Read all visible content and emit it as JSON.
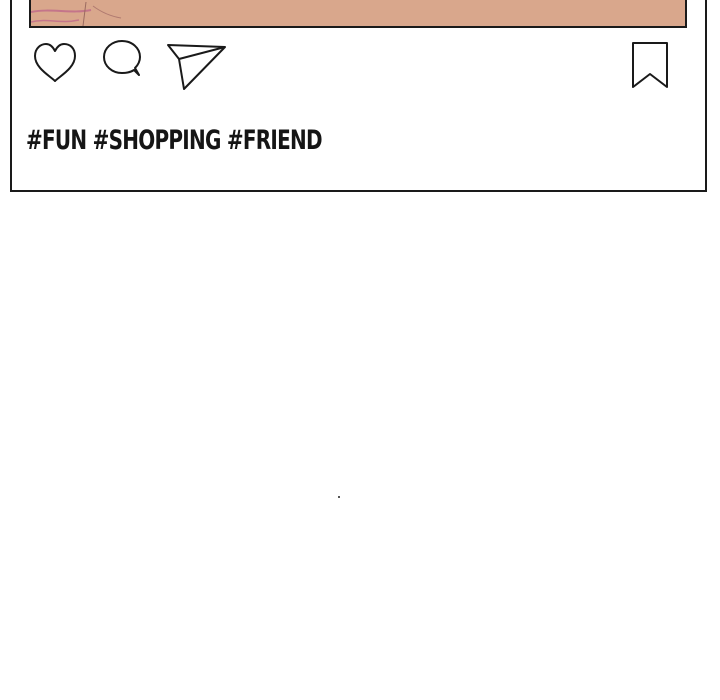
{
  "post": {
    "hashtags": "#FUN #SHOPPING #FRIEND",
    "image_color": "#d9a78c",
    "image_line_color": "#c4758a"
  },
  "actions": {
    "like_icon": "heart-icon",
    "comment_icon": "speech-bubble-icon",
    "share_icon": "paper-plane-icon",
    "save_icon": "bookmark-icon"
  },
  "colors": {
    "ink": "#1a1a1a",
    "background": "#ffffff"
  }
}
